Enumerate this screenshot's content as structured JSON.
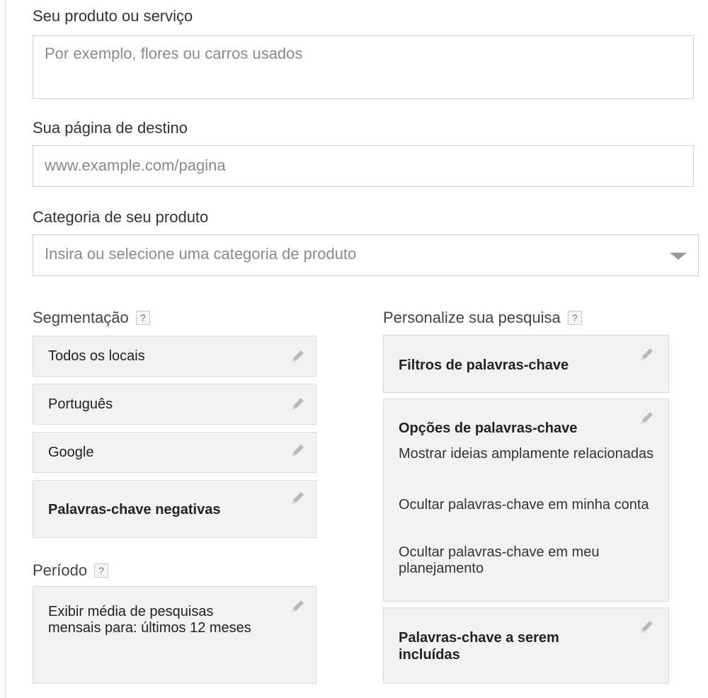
{
  "product": {
    "label": "Seu produto ou serviço",
    "placeholder": "Por exemplo, flores ou carros usados"
  },
  "landing_page": {
    "label": "Sua página de destino",
    "placeholder": "www.example.com/pagina"
  },
  "category": {
    "label": "Categoria de seu produto",
    "placeholder": "Insira ou selecione uma categoria de produto"
  },
  "targeting": {
    "heading": "Segmentação",
    "help": "?",
    "items": [
      {
        "label": "Todos os locais"
      },
      {
        "label": "Português"
      },
      {
        "label": "Google"
      },
      {
        "label": "Palavras-chave negativas"
      }
    ]
  },
  "period": {
    "heading": "Período",
    "help": "?",
    "text": "Exibir média de pesquisas mensais para: últimos 12 meses"
  },
  "customize": {
    "heading": "Personalize sua pesquisa",
    "help": "?",
    "keyword_filters": "Filtros de palavras-chave",
    "keyword_options": {
      "title": "Opções de palavras-chave",
      "lines": [
        "Mostrar ideias amplamente relacionadas",
        "Ocultar palavras-chave em minha conta",
        "Ocultar palavras-chave em meu planejamento"
      ]
    },
    "keywords_to_include": "Palavras-chave a serem incluídas"
  },
  "icons": {
    "edit": "pencil-icon",
    "help": "question-mark-icon",
    "dropdown": "caret-down-icon"
  }
}
